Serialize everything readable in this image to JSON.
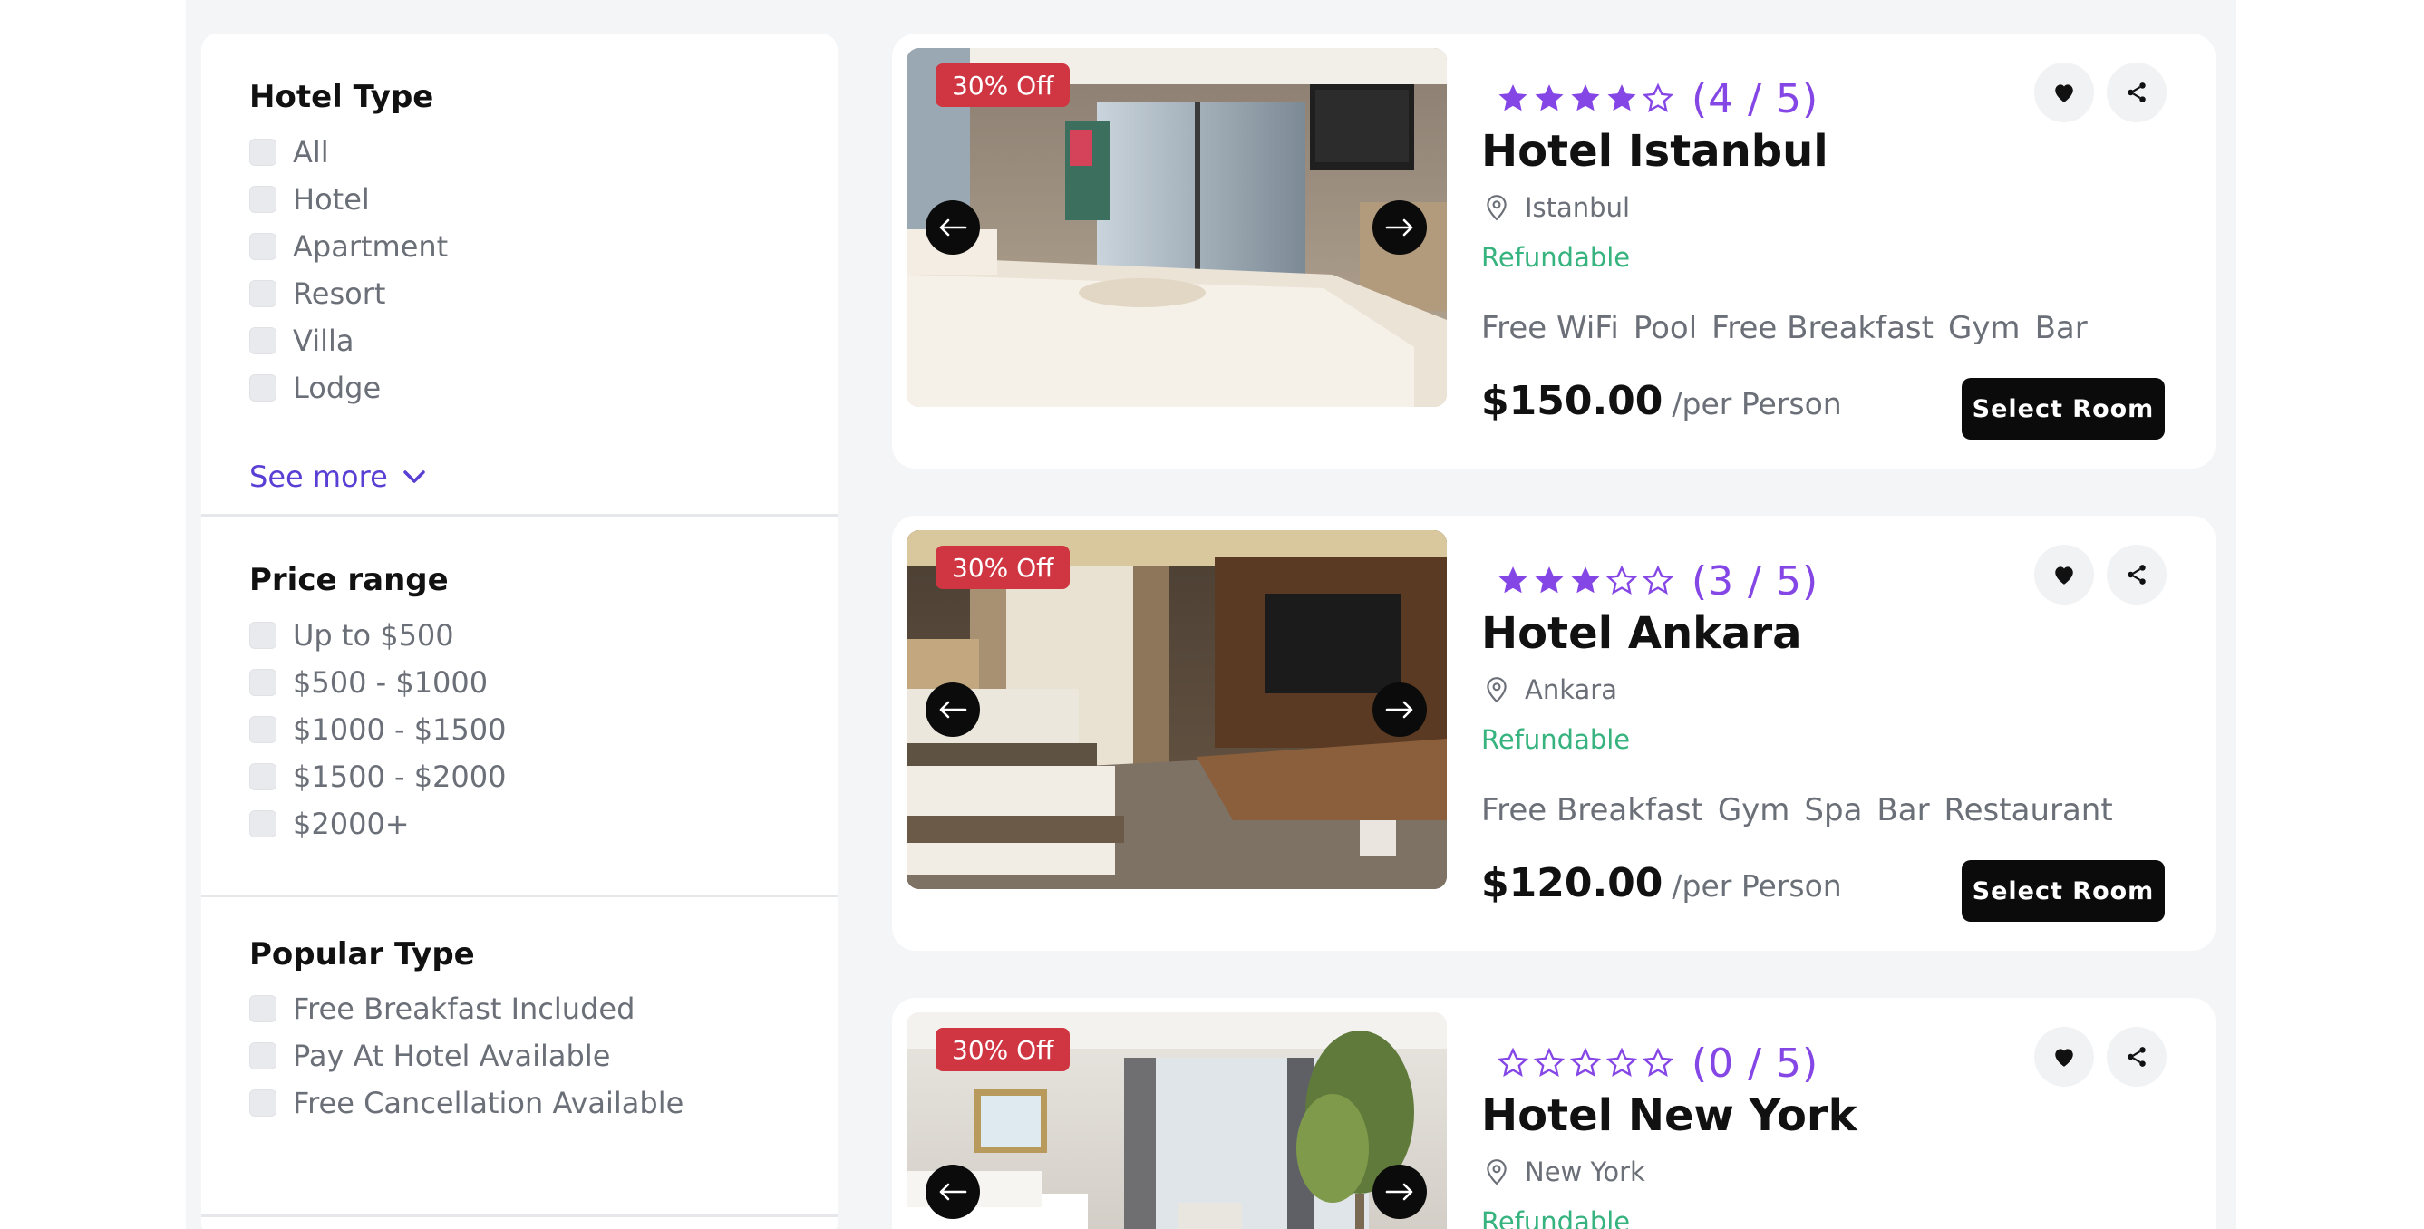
{
  "filters": {
    "hotel_type": {
      "title": "Hotel Type",
      "options": [
        "All",
        "Hotel",
        "Apartment",
        "Resort",
        "Villa",
        "Lodge"
      ],
      "see_more": "See more"
    },
    "price_range": {
      "title": "Price range",
      "options": [
        "Up to $500",
        "$500 - $1000",
        "$1000 - $1500",
        "$1500 - $2000",
        "$2000+"
      ]
    },
    "popular_type": {
      "title": "Popular Type",
      "options": [
        "Free Breakfast Included",
        "Pay At Hotel Available",
        "Free Cancellation Available"
      ]
    }
  },
  "hotels": [
    {
      "discount": "30% Off",
      "rating": 4,
      "rating_text": "(4 / 5)",
      "name": "Hotel Istanbul",
      "location": "Istanbul",
      "refundable": "Refundable",
      "amenities": [
        "Free WiFi",
        "Pool",
        "Free Breakfast",
        "Gym",
        "Bar"
      ],
      "price": "$150.00",
      "per": "/per Person",
      "button": "Select Room"
    },
    {
      "discount": "30% Off",
      "rating": 3,
      "rating_text": "(3 / 5)",
      "name": "Hotel Ankara",
      "location": "Ankara",
      "refundable": "Refundable",
      "amenities": [
        "Free Breakfast",
        "Gym",
        "Spa",
        "Bar",
        "Restaurant"
      ],
      "price": "$120.00",
      "per": "/per Person",
      "button": "Select Room"
    },
    {
      "discount": "30% Off",
      "rating": 0,
      "rating_text": "(0 / 5)",
      "name": "Hotel New York",
      "location": "New York",
      "refundable": "Refundable",
      "amenities": [],
      "price": "",
      "per": "",
      "button": ""
    }
  ],
  "colors": {
    "star": "#8546e6",
    "discount": "#cf3642",
    "refundable": "#36b37e",
    "link": "#5a3fd4"
  }
}
